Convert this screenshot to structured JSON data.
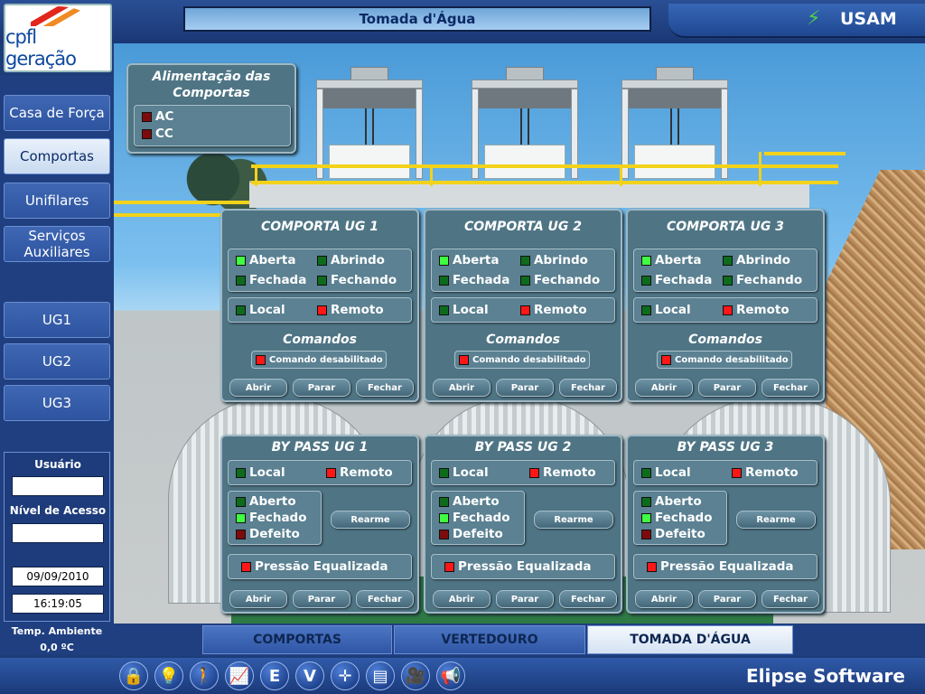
{
  "header": {
    "title": "Tomada d'Água",
    "station": "USAM"
  },
  "logo": {
    "text": "cpfl geração"
  },
  "nav": {
    "items": [
      "Casa de Força",
      "Comportas",
      "Unifilares",
      "Serviços Auxiliares",
      "UG1",
      "UG2",
      "UG3"
    ],
    "active": "Comportas"
  },
  "user": {
    "user_label": "Usuário",
    "access_label": "Nível de Acesso",
    "date": "09/09/2010",
    "time": "16:19:05",
    "temp_label": "Temp. Ambiente",
    "temp_value": "0,0 ºC"
  },
  "alimentacao": {
    "title": "Alimentação das Comportas",
    "ac": "AC",
    "cc": "CC"
  },
  "labels": {
    "aberta": "Aberta",
    "abrindo": "Abrindo",
    "fechada": "Fechada",
    "fechando": "Fechando",
    "local": "Local",
    "remoto": "Remoto",
    "comandos": "Comandos",
    "cmd_disabled": "Comando desabilitado",
    "abrir": "Abrir",
    "parar": "Parar",
    "fechar": "Fechar",
    "aberto": "Aberto",
    "fechado": "Fechado",
    "defeito": "Defeito",
    "rearme": "Rearme",
    "pressao": "Pressão Equalizada"
  },
  "gates": [
    {
      "title": "COMPORTA UG 1",
      "bypass_title": "BY PASS UG 1"
    },
    {
      "title": "COMPORTA UG 2",
      "bypass_title": "BY PASS UG 2"
    },
    {
      "title": "COMPORTA UG 3",
      "bypass_title": "BY PASS UG 3"
    }
  ],
  "tabs": [
    "COMPORTAS",
    "VERTEDOURO",
    "TOMADA D'ÁGUA"
  ],
  "footer": {
    "brand": "Elipse Software"
  },
  "colors": {
    "led_on_green": "#40ff40",
    "led_off_green": "#0d6b1c",
    "led_on_red": "#ff1616",
    "led_off_red": "#7d0b0b",
    "panel": "#4f7585"
  }
}
